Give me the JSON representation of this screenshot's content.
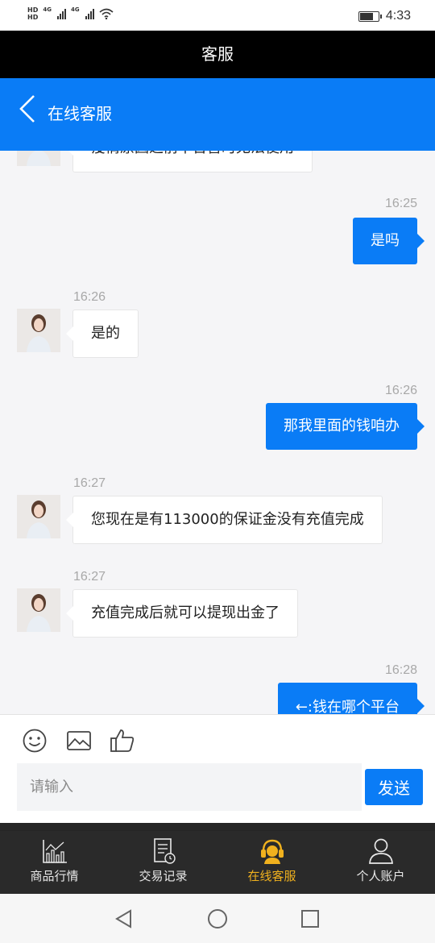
{
  "status_bar": {
    "hd1": "HD",
    "hd2": "HD",
    "net1": "4G",
    "net2": "4G",
    "time": "4:33",
    "battery_level": 0.75,
    "icons": [
      "signal-icon",
      "wifi-icon",
      "battery-icon"
    ]
  },
  "app_title": "客服",
  "header": {
    "back_icon": "chevron-left-icon",
    "title": "在线客服"
  },
  "messages": [
    {
      "side": "left",
      "time": "",
      "text": "疫情原因之前平台暂时无法使用"
    },
    {
      "side": "right",
      "time": "16:25",
      "text": "是吗"
    },
    {
      "side": "left",
      "time": "16:26",
      "text": "是的"
    },
    {
      "side": "right",
      "time": "16:26",
      "text": "那我里面的钱咱办"
    },
    {
      "side": "left",
      "time": "16:27",
      "text": "您现在是有113000的保证金没有充值完成"
    },
    {
      "side": "left",
      "time": "16:27",
      "text": "充值完成后就可以提现出金了"
    },
    {
      "side": "right",
      "time": "16:28",
      "text": "←:钱在哪个平台"
    }
  ],
  "composer": {
    "icons": [
      "emoji-icon",
      "image-icon",
      "thumbs-up-icon"
    ],
    "placeholder": "请输入",
    "send_label": "发送"
  },
  "tabs": [
    {
      "label": "商品行情",
      "icon": "chart-icon",
      "active": false
    },
    {
      "label": "交易记录",
      "icon": "document-clock-icon",
      "active": false
    },
    {
      "label": "在线客服",
      "icon": "headset-icon",
      "active": true
    },
    {
      "label": "个人账户",
      "icon": "user-icon",
      "active": false
    }
  ],
  "colors": {
    "primary": "#0a7cf6",
    "title_bar": "#000000",
    "tab_bar": "#2a2a2a",
    "tab_active": "#f0b11e"
  },
  "system_nav": [
    "back-triangle-icon",
    "home-circle-icon",
    "recents-square-icon"
  ]
}
